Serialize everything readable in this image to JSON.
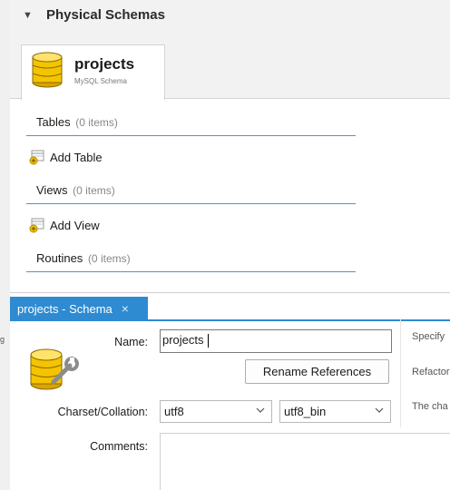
{
  "physical_schemas": {
    "title": "Physical Schemas",
    "collapse_icon": "triangle-down-icon"
  },
  "schema_tab": {
    "name": "projects",
    "subtitle": "MySQL Schema",
    "icon": "database-icon"
  },
  "sections": {
    "tables": {
      "label": "Tables",
      "count": "(0 items)",
      "add_label": "Add Table"
    },
    "views": {
      "label": "Views",
      "count": "(0 items)",
      "add_label": "Add View"
    },
    "routines": {
      "label": "Routines",
      "count": "(0 items)"
    }
  },
  "editor": {
    "tab_label": "projects - Schema",
    "tab_close": "×",
    "name_label": "Name:",
    "name_value": "projects",
    "rename_button": "Rename References",
    "charset_label": "Charset/Collation:",
    "charset_value": "utf8",
    "collation_value": "utf8_bin",
    "comments_label": "Comments:",
    "comments_value": "",
    "hint_name": "Specify",
    "hint_rename": "Refactor",
    "hint_charset": "The cha"
  },
  "colors": {
    "accent": "#2e8bd1",
    "section_line": "#5c8ec8",
    "header_bg": "#f2f2f2",
    "db_icon_yellow": "#f5c400"
  }
}
